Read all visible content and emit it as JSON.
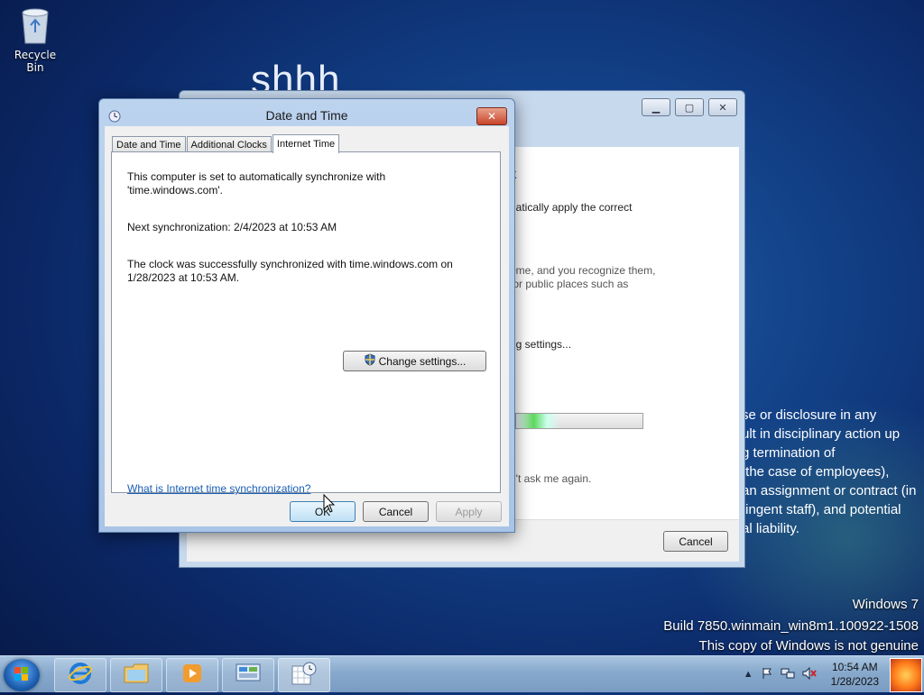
{
  "desktop": {
    "recycle_bin_label": "Recycle Bin",
    "background_text": "shhh",
    "watermark": {
      "line1": "Windows 7",
      "line2": "Build 7850.winmain_win8m1.100922-1508",
      "line3": "This copy of Windows is not genuine"
    },
    "notice_text": "se or disclosure in any\nult in disciplinary action up\ng termination of\n the case of employees),\nan assignment or contract (in\ntingent staff), and potential\nal liability."
  },
  "background_window": {
    "heading_fragment": "k",
    "line1": "natically apply the correct",
    "line2": "ome, and you recognize them,",
    "line3": "for public places such as",
    "line4": "ng settings...",
    "progress_fraction": 0.35,
    "line5": "n't ask me again.",
    "cancel_label": "Cancel"
  },
  "dialog": {
    "title": "Date and Time",
    "tabs": [
      {
        "label": "Date and Time",
        "active": false
      },
      {
        "label": "Additional Clocks",
        "active": false
      },
      {
        "label": "Internet Time",
        "active": true
      }
    ],
    "sync_text": "This computer is set to automatically synchronize with\n'time.windows.com'.",
    "next_sync": "Next synchronization: 2/4/2023 at 10:53 AM",
    "last_sync": "The clock was successfully synchronized with time.windows.com on\n1/28/2023 at 10:53 AM.",
    "change_settings_label": "Change settings...",
    "help_link": "What is Internet time synchronization?",
    "ok_label": "OK",
    "cancel_label": "Cancel",
    "apply_label": "Apply"
  },
  "taskbar": {
    "items": [
      "internet-explorer",
      "windows-explorer",
      "media-player",
      "control-panel",
      "date-time"
    ],
    "clock_time": "10:54 AM",
    "clock_date": "1/28/2023"
  },
  "colors": {
    "link": "#1a5fb4",
    "close_button": "#c7452a",
    "progress_fill": "#5dd85d"
  }
}
